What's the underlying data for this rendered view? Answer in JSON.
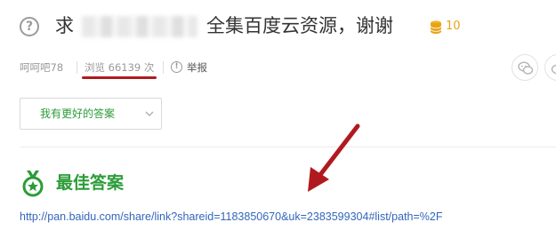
{
  "question": {
    "prefix": "求",
    "suffix": "全集百度云资源，谢谢",
    "icon": "question-circle-icon",
    "reward": {
      "icon": "coin-stack-icon",
      "amount": "10",
      "color": "#e8a415"
    }
  },
  "meta": {
    "user": "呵呵吧78",
    "views": "浏览 66139 次",
    "report_label": "举报",
    "share_icons": [
      "wechat-icon",
      "weibo-icon"
    ]
  },
  "better_answer": {
    "label": "我有更好的答案"
  },
  "best_answer": {
    "title": "最佳答案",
    "icon": "medal-icon",
    "link_text": "http://pan.baidu.com/share/link?shareid=1183850670&uk=2383599304#list/path=%2F"
  },
  "colors": {
    "accent_green": "#2b9c38",
    "link_blue": "#3366bb",
    "annotation_red": "#b01a1f"
  }
}
